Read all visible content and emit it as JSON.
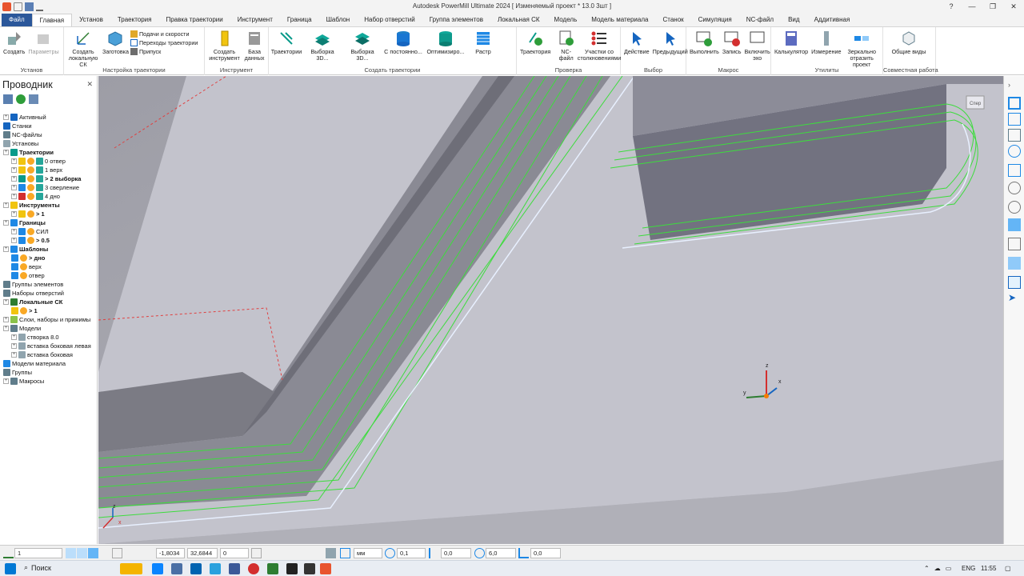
{
  "window": {
    "title": "Autodesk PowerMill Ultimate 2024  [ Изменяемый проект * 13.0 3шт ]"
  },
  "tabs": [
    {
      "label": "Файл"
    },
    {
      "label": "Главная"
    },
    {
      "label": "Установ"
    },
    {
      "label": "Траектория"
    },
    {
      "label": "Правка траектории"
    },
    {
      "label": "Инструмент"
    },
    {
      "label": "Граница"
    },
    {
      "label": "Шаблон"
    },
    {
      "label": "Набор отверстий"
    },
    {
      "label": "Группа элементов"
    },
    {
      "label": "Локальная СК"
    },
    {
      "label": "Модель"
    },
    {
      "label": "Модель материала"
    },
    {
      "label": "Станок"
    },
    {
      "label": "Симуляция"
    },
    {
      "label": "NC-файл"
    },
    {
      "label": "Вид"
    },
    {
      "label": "Аддитивная"
    }
  ],
  "ribbon": {
    "setup": {
      "label": "Установ",
      "create": "Создать",
      "params": "Параметры"
    },
    "toolpath_setup": {
      "label": "Настройка траектории",
      "local_cs": "Создать локальную СК",
      "stock": "Заготовка",
      "feeds": "Подачи и скорости",
      "leads": "Переходы траектории",
      "allowance": "Припуск"
    },
    "tool": {
      "label": "Инструмент",
      "create_tool": "Создать инструмент",
      "database": "База данных"
    },
    "create_toolpath": {
      "label": "Создать траектории",
      "toolpaths": "Траектории",
      "b1": "Выборка 3D...",
      "b2": "Выборка 3D...",
      "b3": "С постоянно...",
      "b4": "Оптимизиро...",
      "b5": "Растр"
    },
    "verify": {
      "label": "Проверка",
      "trajectory": "Траектория",
      "ncfile": "NC-файл",
      "collisions": "Участки со столкновениями"
    },
    "select": {
      "label": "Выбор",
      "action": "Действие",
      "previous": "Предыдущий"
    },
    "macro": {
      "label": "Макрос",
      "run": "Выполнить",
      "record": "Запись",
      "echo": "Включить эхо"
    },
    "utils": {
      "label": "Утилиты",
      "calculator": "Калькулятор",
      "measure": "Измерение",
      "mirror": "Зеркально отразить проект"
    },
    "collab": {
      "label": "Совместная работа",
      "shared_views": "Общие виды"
    }
  },
  "explorer": {
    "title": "Проводник",
    "items": [
      {
        "label": "Активный",
        "bold": false
      },
      {
        "label": "Станки",
        "bold": false
      },
      {
        "label": "NC-файлы",
        "bold": false
      },
      {
        "label": "Установы",
        "bold": false
      },
      {
        "label": "Траектории",
        "bold": true
      },
      {
        "label": "0 отвер",
        "bold": false
      },
      {
        "label": "1 верх",
        "bold": false
      },
      {
        "label": "> 2 выборка",
        "bold": true
      },
      {
        "label": "3 сверление",
        "bold": false
      },
      {
        "label": "4 дно",
        "bold": false
      },
      {
        "label": "Инструменты",
        "bold": true
      },
      {
        "label": "> 1",
        "bold": true
      },
      {
        "label": "Границы",
        "bold": true
      },
      {
        "label": "СИЛ",
        "bold": false
      },
      {
        "label": "> 0.5",
        "bold": true
      },
      {
        "label": "Шаблоны",
        "bold": true
      },
      {
        "label": "> дно",
        "bold": true
      },
      {
        "label": "верх",
        "bold": false
      },
      {
        "label": "отвер",
        "bold": false
      },
      {
        "label": "Группы элементов",
        "bold": false
      },
      {
        "label": "Наборы отверстий",
        "bold": false
      },
      {
        "label": "Локальные СК",
        "bold": true
      },
      {
        "label": "> 1",
        "bold": true
      },
      {
        "label": "Слои, наборы и прижимы",
        "bold": false
      },
      {
        "label": "Модели",
        "bold": false
      },
      {
        "label": "створка 8.0",
        "bold": false
      },
      {
        "label": "вставка боковая левая",
        "bold": false
      },
      {
        "label": "вставка боковая",
        "bold": false
      },
      {
        "label": "Модели материала",
        "bold": false
      },
      {
        "label": "Группы",
        "bold": false
      },
      {
        "label": "Макросы",
        "bold": false
      }
    ]
  },
  "viewport": {
    "cube_label": "Спер",
    "axis": {
      "x": "x",
      "y": "y",
      "z": "z"
    }
  },
  "status": {
    "layer": "1",
    "x": "-1,8034",
    "y": "32,6844",
    "z": "0",
    "units": "мм",
    "tol": "0,1",
    "stock": "0,0",
    "diameter": "6,0",
    "angle": "0,0"
  },
  "taskbar": {
    "search": "Поиск",
    "lang": "ENG",
    "time": "11:55"
  }
}
